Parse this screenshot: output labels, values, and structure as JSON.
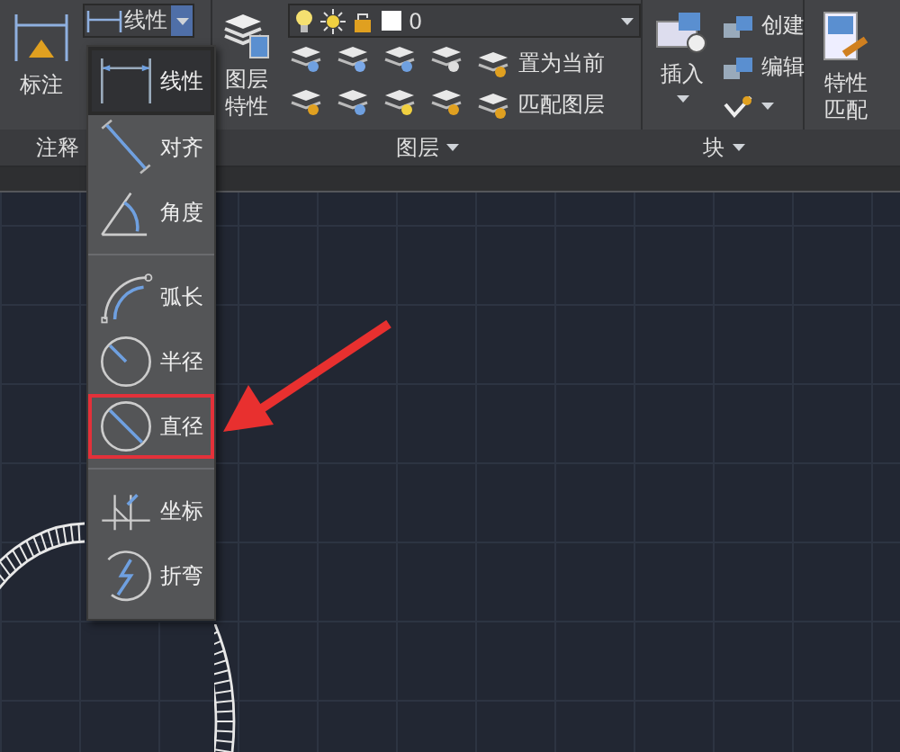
{
  "annotation_panel": {
    "label": "注释",
    "dimension_button": "标注",
    "dimension_combo": {
      "value": "线性"
    }
  },
  "layers_panel": {
    "label": "图层",
    "properties_button": "图层特性",
    "layer_combo": {
      "value": "0"
    },
    "commands": [
      "置为当前",
      "匹配图层"
    ]
  },
  "block_panel": {
    "label": "块",
    "insert_button": "插入",
    "commands": [
      "创建",
      "编辑"
    ]
  },
  "match_button": "特性匹配",
  "dimension_menu": {
    "groups": [
      [
        {
          "kind": "linear",
          "label": "线性",
          "selected": true,
          "highlighted": false
        },
        {
          "kind": "aligned",
          "label": "对齐",
          "selected": false,
          "highlighted": false
        },
        {
          "kind": "angular",
          "label": "角度",
          "selected": false,
          "highlighted": false
        }
      ],
      [
        {
          "kind": "arc",
          "label": "弧长",
          "selected": false,
          "highlighted": false
        },
        {
          "kind": "radius",
          "label": "半径",
          "selected": false,
          "highlighted": false
        },
        {
          "kind": "diameter",
          "label": "直径",
          "selected": false,
          "highlighted": true
        }
      ],
      [
        {
          "kind": "ordinate",
          "label": "坐标",
          "selected": false,
          "highlighted": false
        },
        {
          "kind": "jogged",
          "label": "折弯",
          "selected": false,
          "highlighted": false
        }
      ]
    ]
  },
  "callout_arrow": true
}
